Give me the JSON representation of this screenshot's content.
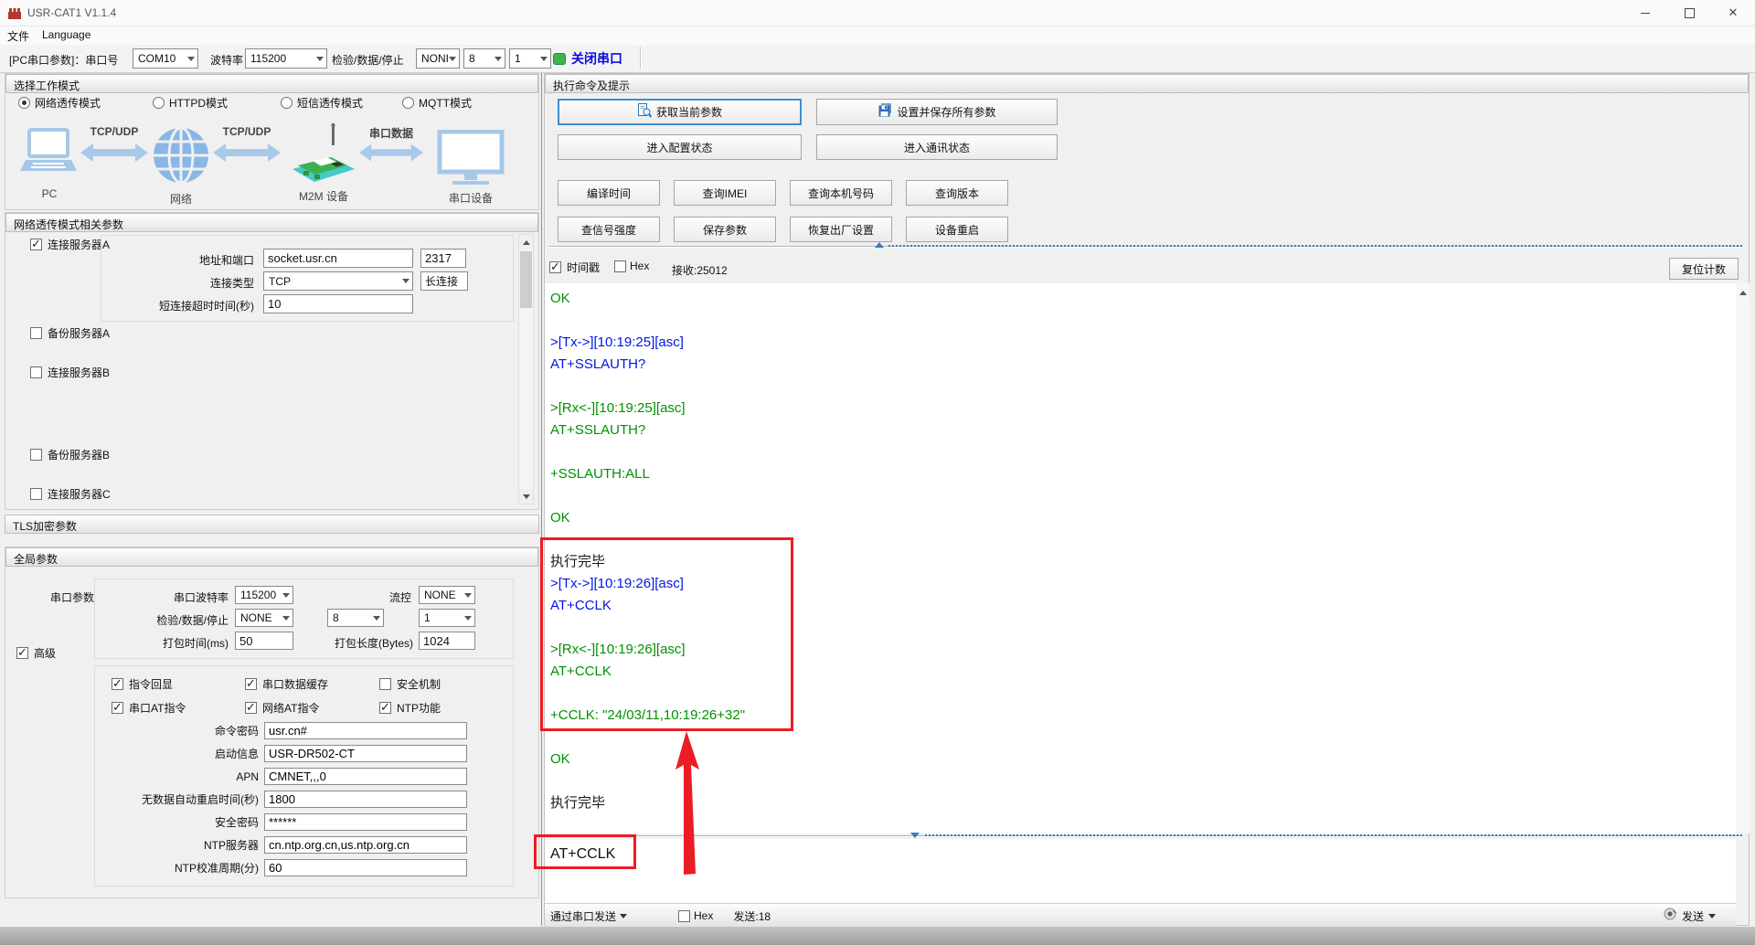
{
  "colors": {
    "log_green": "#009100",
    "log_blue": "#0014e6",
    "annotation_red": "#ec1c24",
    "close_icon_green": "#3cb44b",
    "focus_border_blue": "#3f8cd5"
  },
  "window": {
    "title": "USR-CAT1 V1.1.4",
    "menu": [
      "文件",
      "Language"
    ]
  },
  "toolbar": {
    "port_label": "[PC串口参数]：串口号",
    "port": "COM10",
    "baud_label": "波特率",
    "baud": "115200",
    "parity_label": "检验/数据/停止",
    "parity": "NONI",
    "databits": "8",
    "stopbits": "1",
    "close_button": "关闭串口"
  },
  "work_mode": {
    "header": "选择工作模式",
    "options": [
      {
        "label": "网络透传模式",
        "selected": true
      },
      {
        "label": "HTTPD模式",
        "selected": false
      },
      {
        "label": "短信透传模式",
        "selected": false
      },
      {
        "label": "MQTT模式",
        "selected": false
      }
    ],
    "diagram": {
      "nodes": [
        {
          "label": "PC"
        },
        {
          "label": "网络"
        },
        {
          "label": "M2M 设备"
        },
        {
          "label": "串口设备"
        }
      ],
      "links": [
        "TCP/UDP",
        "TCP/UDP",
        "串口数据"
      ]
    }
  },
  "net_params": {
    "header": "网络透传模式相关参数",
    "server_a": {
      "label": "连接服务器A",
      "checked": true,
      "addr_label": "地址和端口",
      "addr": "socket.usr.cn",
      "port": "2317",
      "type_label": "连接类型",
      "type": "TCP",
      "keep": "长连接",
      "timeout_label": "短连接超时时间(秒)",
      "timeout": "10"
    },
    "checkboxes": [
      {
        "label": "备份服务器A",
        "checked": false
      },
      {
        "label": "连接服务器B",
        "checked": false
      },
      {
        "label": "备份服务器B",
        "checked": false
      },
      {
        "label": "连接服务器C",
        "checked": false
      }
    ]
  },
  "tls": {
    "header": "TLS加密参数"
  },
  "global_params": {
    "header": "全局参数",
    "serial_section_label": "串口参数",
    "serial": {
      "baud_label": "串口波特率",
      "baud": "115200",
      "flow_label": "流控",
      "flow": "NONE",
      "parity_label": "检验/数据/停止",
      "parity": "NONE",
      "databits": "8",
      "stopbits": "1",
      "pack_time_label": "打包时间(ms)",
      "pack_time": "50",
      "pack_len_label": "打包长度(Bytes)",
      "pack_len": "1024"
    },
    "advanced_label": "高级",
    "advanced_checked": true,
    "feature_checks": [
      {
        "label": "指令回显",
        "checked": true
      },
      {
        "label": "串口数据缓存",
        "checked": true
      },
      {
        "label": "安全机制",
        "checked": false
      },
      {
        "label": "串口AT指令",
        "checked": true
      },
      {
        "label": "网络AT指令",
        "checked": true
      },
      {
        "label": "NTP功能",
        "checked": true
      }
    ],
    "fields": [
      {
        "label": "命令密码",
        "value": "usr.cn#"
      },
      {
        "label": "启动信息",
        "value": "USR-DR502-CT"
      },
      {
        "label": "APN",
        "value": "CMNET,,,0"
      },
      {
        "label": "无数据自动重启时间(秒)",
        "value": "1800"
      },
      {
        "label": "安全密码",
        "value": "******"
      },
      {
        "label": "NTP服务器",
        "value": "cn.ntp.org.cn,us.ntp.org.cn"
      },
      {
        "label": "NTP校准周期(分)",
        "value": "60"
      }
    ]
  },
  "command_panel": {
    "header": "执行命令及提示",
    "primary": {
      "get": "获取当前参数",
      "set_save": "设置并保存所有参数",
      "enter_config": "进入配置状态",
      "enter_comm": "进入通讯状态"
    },
    "small_buttons": [
      "编译时间",
      "查询IMEI",
      "查询本机号码",
      "查询版本",
      "查信号强度",
      "保存参数",
      "恢复出厂设置",
      "设备重启"
    ]
  },
  "log": {
    "timestamp_label": "时间戳",
    "timestamp_checked": true,
    "hex_label": "Hex",
    "hex_checked": false,
    "recv_label": "接收:25012",
    "reset_button": "复位计数",
    "lines": [
      {
        "text": "OK",
        "color": "g"
      },
      {
        "text": "",
        "color": "g"
      },
      {
        "text": ">[Tx->][10:19:25][asc]",
        "color": "b"
      },
      {
        "text": "AT+SSLAUTH?",
        "color": "b"
      },
      {
        "text": "",
        "color": "b"
      },
      {
        "text": ">[Rx<-][10:19:25][asc]",
        "color": "g"
      },
      {
        "text": "AT+SSLAUTH?",
        "color": "g"
      },
      {
        "text": "",
        "color": "g"
      },
      {
        "text": "+SSLAUTH:ALL",
        "color": "g"
      },
      {
        "text": "",
        "color": "g"
      },
      {
        "text": "OK",
        "color": "g"
      },
      {
        "text": "",
        "color": "g"
      },
      {
        "text": "执行完毕",
        "color": "k"
      },
      {
        "text": ">[Tx->][10:19:26][asc]",
        "color": "b"
      },
      {
        "text": "AT+CCLK",
        "color": "b"
      },
      {
        "text": "",
        "color": "b"
      },
      {
        "text": ">[Rx<-][10:19:26][asc]",
        "color": "g"
      },
      {
        "text": "AT+CCLK",
        "color": "g"
      },
      {
        "text": "",
        "color": "g"
      },
      {
        "text": "+CCLK: \"24/03/11,10:19:26+32\"",
        "color": "g"
      },
      {
        "text": "",
        "color": "g"
      },
      {
        "text": "OK",
        "color": "g"
      },
      {
        "text": "",
        "color": "g"
      },
      {
        "text": "执行完毕",
        "color": "k"
      }
    ]
  },
  "send": {
    "input": "AT+CCLK",
    "via_label": "通过串口发送",
    "hex_label": "Hex",
    "hex_checked": false,
    "count_label": "发送:18",
    "send_label": "发送"
  }
}
